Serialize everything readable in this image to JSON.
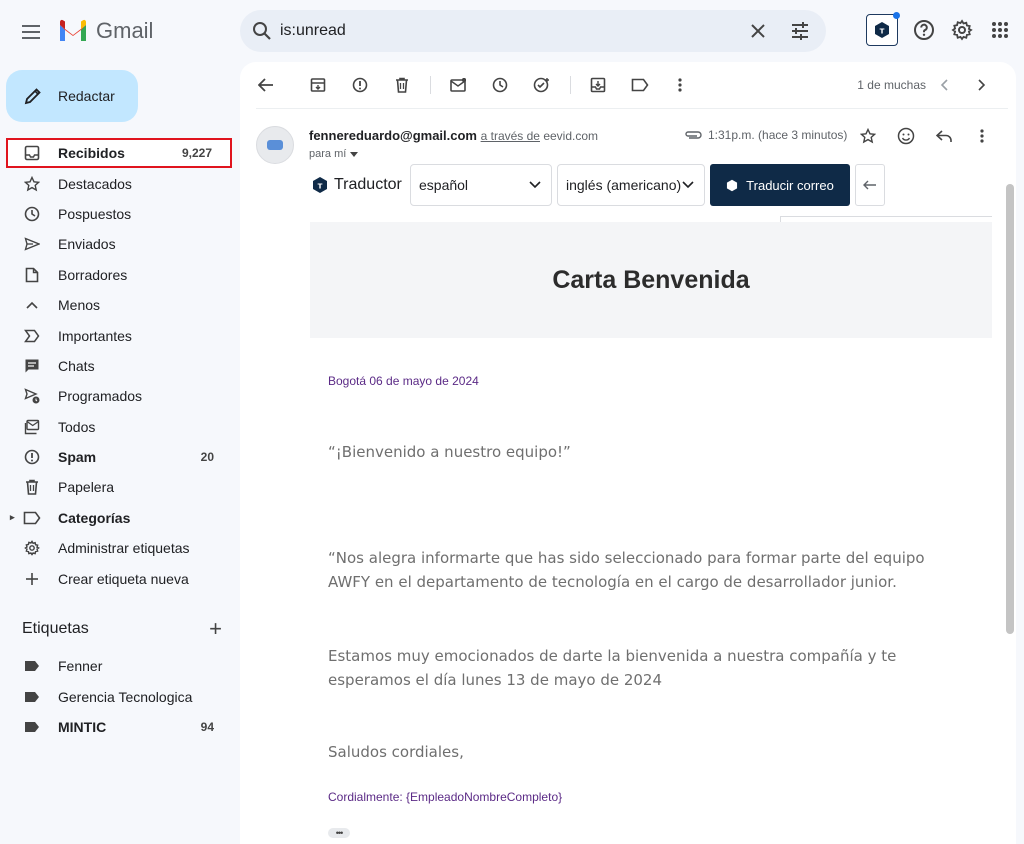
{
  "app": {
    "name": "Gmail"
  },
  "search": {
    "value": "is:unread"
  },
  "compose": {
    "label": "Redactar"
  },
  "nav": [
    {
      "label": "Recibidos",
      "count": "9,227",
      "icon": "inbox-icon",
      "bold": true,
      "selected": true
    },
    {
      "label": "Destacados",
      "count": "",
      "icon": "star-icon"
    },
    {
      "label": "Pospuestos",
      "count": "",
      "icon": "clock-icon"
    },
    {
      "label": "Enviados",
      "count": "",
      "icon": "send-icon"
    },
    {
      "label": "Borradores",
      "count": "",
      "icon": "draft-icon"
    },
    {
      "label": "Menos",
      "count": "",
      "icon": "chevron-up-icon"
    },
    {
      "label": "Importantes",
      "count": "",
      "icon": "important-icon"
    },
    {
      "label": "Chats",
      "count": "",
      "icon": "chat-icon"
    },
    {
      "label": "Programados",
      "count": "",
      "icon": "scheduled-icon"
    },
    {
      "label": "Todos",
      "count": "",
      "icon": "all-mail-icon"
    },
    {
      "label": "Spam",
      "count": "20",
      "icon": "spam-icon",
      "bold": true
    },
    {
      "label": "Papelera",
      "count": "",
      "icon": "trash-icon"
    },
    {
      "label": "Categorías",
      "count": "",
      "icon": "label-outline-icon",
      "bold": true
    },
    {
      "label": "Administrar etiquetas",
      "count": "",
      "icon": "gear-icon"
    },
    {
      "label": "Crear etiqueta nueva",
      "count": "",
      "icon": "plus-icon"
    }
  ],
  "labels_section": {
    "title": "Etiquetas",
    "items": [
      {
        "label": "Fenner",
        "count": ""
      },
      {
        "label": "Gerencia Tecnologica",
        "count": ""
      },
      {
        "label": "MINTIC",
        "count": "94",
        "bold": true
      }
    ]
  },
  "toolbar": {
    "pager": "1 de muchas"
  },
  "email": {
    "sender": "fennereduardo@gmail.com",
    "via_prefix": "a través de",
    "via_domain": "eevid.com",
    "to": "para mí",
    "time": "1:31p.m. (hace 3 minutos)"
  },
  "translator": {
    "label": "Traductor",
    "source_lang": "español",
    "target_lang": "inglés (americano)",
    "button": "Traducir correo"
  },
  "letter": {
    "title": "Carta Benvenida",
    "date_line": "Bogotá 06 de mayo de 2024",
    "welcome": "“¡Bienvenido a nuestro equipo!”",
    "p1_line1": "“Nos alegra informarte  que has sido seleccionado para formar parte del equipo",
    "p1_line2": "AWFY en el departamento de tecnología en el cargo de desarrollador junior.",
    "p2_line1": "Estamos muy emocionados de darte la bienvenida a nuestra compañía y te",
    "p2_line2": "esperamos el día lunes 13 de mayo de 2024",
    "closing": "Saludos cordiales,",
    "signature": "Cordialmente: {EmpleadoNombreCompleto}"
  },
  "colors": {
    "selected_border": "#e0141e",
    "compose_bg": "#c2e7ff",
    "translate_button": "#0f2a47",
    "letter_purple": "#5b2a86"
  }
}
